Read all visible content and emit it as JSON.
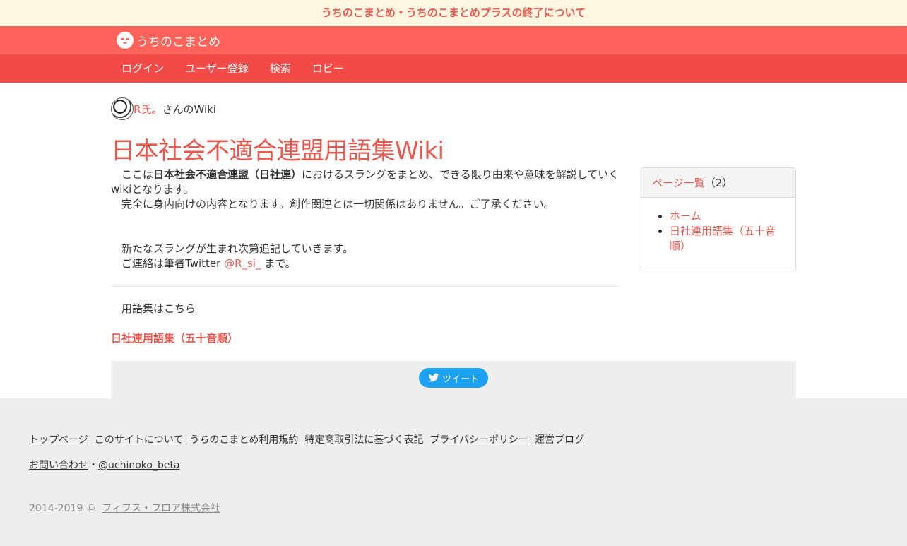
{
  "notice": {
    "text": "うちのこまとめ・うちのこまとめプラスの終了について"
  },
  "brand": {
    "name": "うちのこまとめ"
  },
  "nav": {
    "items": [
      "ログイン",
      "ユーザー登録",
      "検索",
      "ロビー"
    ]
  },
  "owner": {
    "name": "R氏。",
    "suffix": "さんのWiki"
  },
  "page": {
    "title": "日本社会不適合連盟用語集Wiki",
    "intro_prefix": "ここは",
    "intro_bold": "日本社会不適合連盟（日社連）",
    "intro_suffix": "におけるスラングをまとめ、できる限り由来や意味を解説していくwikiとなります。",
    "line2": "完全に身内向けの内容となります。創作関連とは一切関係はありません。ご了承ください。",
    "line3": "新たなスラングが生まれ次第追記していきます。",
    "line4_prefix": "ご連絡は筆者Twitter",
    "line4_link": "@R_si_",
    "line4_suffix": "まで。",
    "glossary_text": "用語集はこちら",
    "glossary_link": "日社連用語集（五十音順）"
  },
  "sidebar": {
    "title": "ページ一覧",
    "count": "（2）",
    "pages": [
      "ホーム",
      "日社連用語集（五十音順）"
    ]
  },
  "share": {
    "tweet_label": "ツイート"
  },
  "footer": {
    "links": [
      "トップページ",
      "このサイトについて",
      "うちのこまとめ利用規約",
      "特定商取引法に基づく表記",
      "プライバシーポリシー",
      "運営ブログ"
    ],
    "contact": "お問い合わせ",
    "separator": "・",
    "twitter": "@uchinoko_beta",
    "copyright": "2014-2019 ©",
    "company": "フィフス・フロア株式会社"
  },
  "colors": {
    "accent": "#e8584e",
    "brandbar": "#ff6359",
    "navbar": "#f24a47",
    "notice_bg": "#fef6e1",
    "footer_bg": "#eeeeee",
    "twitter": "#1da1f2"
  }
}
